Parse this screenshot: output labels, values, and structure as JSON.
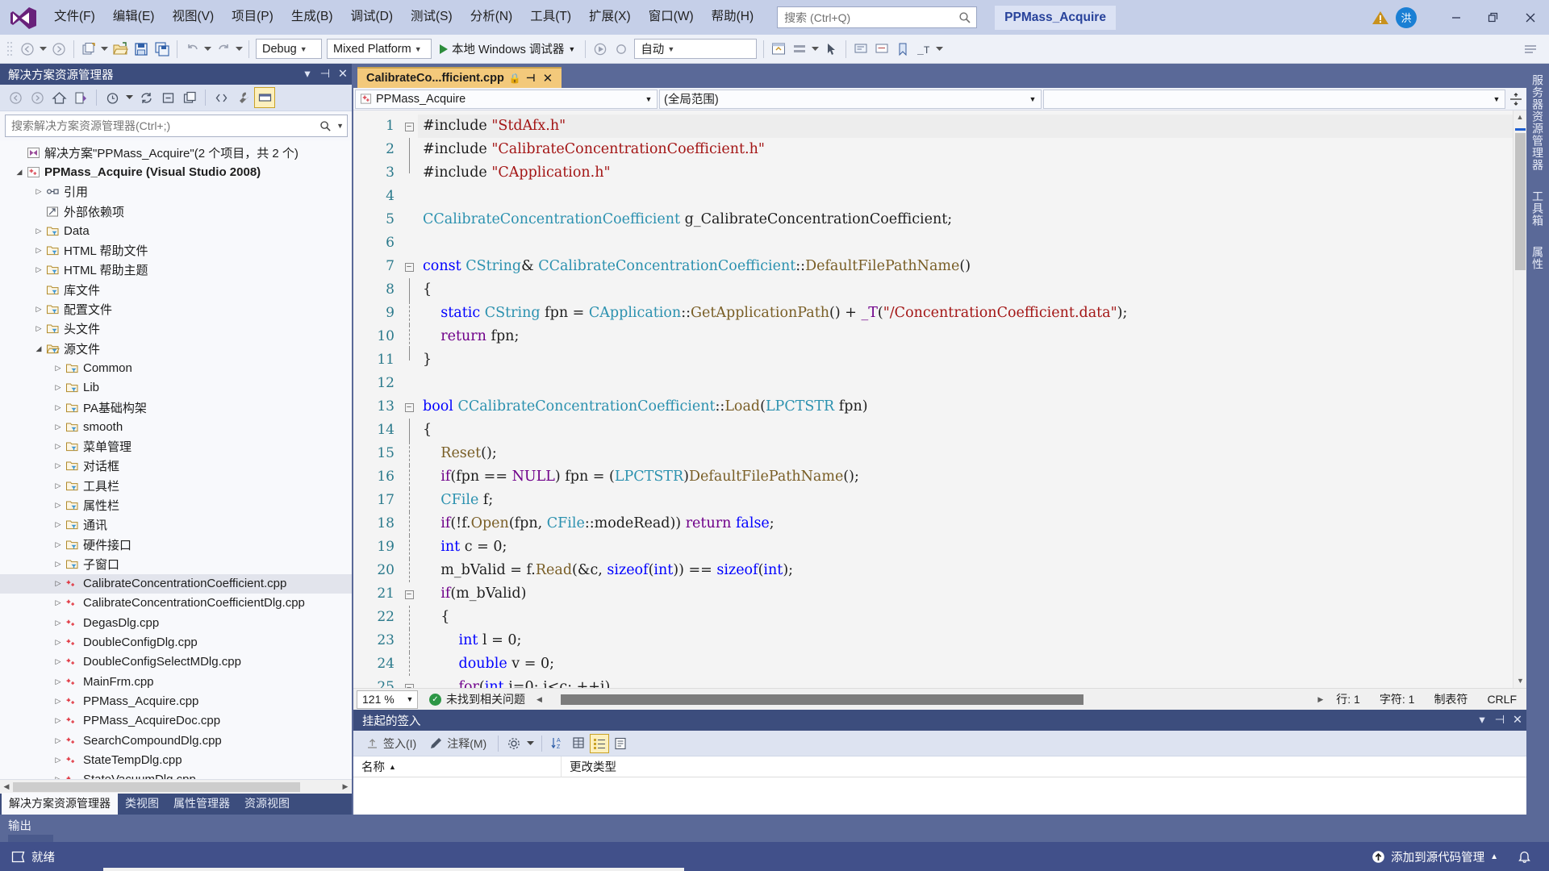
{
  "titlebar": {
    "menus": [
      {
        "label": "文件(F)"
      },
      {
        "label": "编辑(E)"
      },
      {
        "label": "视图(V)"
      },
      {
        "label": "项目(P)"
      },
      {
        "label": "生成(B)"
      },
      {
        "label": "调试(D)"
      },
      {
        "label": "测试(S)"
      },
      {
        "label": "分析(N)"
      },
      {
        "label": "工具(T)"
      },
      {
        "label": "扩展(X)"
      },
      {
        "label": "窗口(W)"
      },
      {
        "label": "帮助(H)"
      }
    ],
    "search_placeholder": "搜索 (Ctrl+Q)",
    "project_title": "PPMass_Acquire",
    "avatar_initial": "洪",
    "logo_name": "visual-studio-logo",
    "minimize": "—",
    "restore": "❐",
    "close": "✕"
  },
  "toolbar": {
    "config": "Debug",
    "platform": "Mixed Platform",
    "run_label": "本地 Windows 调试器",
    "auto": "自动"
  },
  "solution_explorer": {
    "title": "解决方案资源管理器",
    "search_placeholder": "搜索解决方案资源管理器(Ctrl+;)",
    "tree": [
      {
        "depth": 0,
        "arrow": "",
        "icon": "solution-icon",
        "label": "解决方案\"PPMass_Acquire\"(2 个项目，共 2 个)",
        "bold": false
      },
      {
        "depth": 0,
        "arrow": "▲",
        "icon": "cpp-project-icon",
        "label": "PPMass_Acquire (Visual Studio 2008)",
        "bold": true
      },
      {
        "depth": 1,
        "arrow": "▶",
        "icon": "references-icon",
        "label": "引用",
        "bold": false
      },
      {
        "depth": 1,
        "arrow": "",
        "icon": "external-deps-icon",
        "label": "外部依赖项",
        "bold": false
      },
      {
        "depth": 1,
        "arrow": "▶",
        "icon": "filter-folder-icon",
        "label": "Data",
        "bold": false
      },
      {
        "depth": 1,
        "arrow": "▶",
        "icon": "filter-folder-icon",
        "label": "HTML 帮助文件",
        "bold": false
      },
      {
        "depth": 1,
        "arrow": "▶",
        "icon": "filter-folder-icon",
        "label": "HTML 帮助主题",
        "bold": false
      },
      {
        "depth": 1,
        "arrow": "",
        "icon": "filter-folder-icon",
        "label": "库文件",
        "bold": false
      },
      {
        "depth": 1,
        "arrow": "▶",
        "icon": "filter-folder-icon",
        "label": "配置文件",
        "bold": false
      },
      {
        "depth": 1,
        "arrow": "▶",
        "icon": "filter-folder-icon",
        "label": "头文件",
        "bold": false
      },
      {
        "depth": 1,
        "arrow": "▲",
        "icon": "filter-folder-open-icon",
        "label": "源文件",
        "bold": false
      },
      {
        "depth": 2,
        "arrow": "▶",
        "icon": "filter-folder-icon",
        "label": "Common",
        "bold": false
      },
      {
        "depth": 2,
        "arrow": "▶",
        "icon": "filter-folder-icon",
        "label": "Lib",
        "bold": false
      },
      {
        "depth": 2,
        "arrow": "▶",
        "icon": "filter-folder-icon",
        "label": "PA基础构架",
        "bold": false
      },
      {
        "depth": 2,
        "arrow": "▶",
        "icon": "filter-folder-icon",
        "label": "smooth",
        "bold": false
      },
      {
        "depth": 2,
        "arrow": "▶",
        "icon": "filter-folder-icon",
        "label": "菜单管理",
        "bold": false
      },
      {
        "depth": 2,
        "arrow": "▶",
        "icon": "filter-folder-icon",
        "label": "对话框",
        "bold": false
      },
      {
        "depth": 2,
        "arrow": "▶",
        "icon": "filter-folder-icon",
        "label": "工具栏",
        "bold": false
      },
      {
        "depth": 2,
        "arrow": "▶",
        "icon": "filter-folder-icon",
        "label": "属性栏",
        "bold": false
      },
      {
        "depth": 2,
        "arrow": "▶",
        "icon": "filter-folder-icon",
        "label": "通讯",
        "bold": false
      },
      {
        "depth": 2,
        "arrow": "▶",
        "icon": "filter-folder-icon",
        "label": "硬件接口",
        "bold": false
      },
      {
        "depth": 2,
        "arrow": "▶",
        "icon": "filter-folder-icon",
        "label": "子窗口",
        "bold": false
      },
      {
        "depth": 2,
        "arrow": "▶",
        "icon": "cpp-file-icon",
        "label": "CalibrateConcentrationCoefficient.cpp",
        "bold": false,
        "selected": true
      },
      {
        "depth": 2,
        "arrow": "▶",
        "icon": "cpp-file-icon",
        "label": "CalibrateConcentrationCoefficientDlg.cpp",
        "bold": false
      },
      {
        "depth": 2,
        "arrow": "▶",
        "icon": "cpp-file-icon",
        "label": "DegasDlg.cpp",
        "bold": false
      },
      {
        "depth": 2,
        "arrow": "▶",
        "icon": "cpp-file-icon",
        "label": "DoubleConfigDlg.cpp",
        "bold": false
      },
      {
        "depth": 2,
        "arrow": "▶",
        "icon": "cpp-file-icon",
        "label": "DoubleConfigSelectMDlg.cpp",
        "bold": false
      },
      {
        "depth": 2,
        "arrow": "▶",
        "icon": "cpp-file-icon",
        "label": "MainFrm.cpp",
        "bold": false
      },
      {
        "depth": 2,
        "arrow": "▶",
        "icon": "cpp-file-icon",
        "label": "PPMass_Acquire.cpp",
        "bold": false
      },
      {
        "depth": 2,
        "arrow": "▶",
        "icon": "cpp-file-icon",
        "label": "PPMass_AcquireDoc.cpp",
        "bold": false
      },
      {
        "depth": 2,
        "arrow": "▶",
        "icon": "cpp-file-icon",
        "label": "SearchCompoundDlg.cpp",
        "bold": false
      },
      {
        "depth": 2,
        "arrow": "▶",
        "icon": "cpp-file-icon",
        "label": "StateTempDlg.cpp",
        "bold": false
      },
      {
        "depth": 2,
        "arrow": "▶",
        "icon": "cpp-file-icon",
        "label": "StateVacuumDlg.cpp",
        "bold": false
      }
    ],
    "tabs": [
      {
        "label": "解决方案资源管理器",
        "active": true
      },
      {
        "label": "类视图",
        "active": false
      },
      {
        "label": "属性管理器",
        "active": false
      },
      {
        "label": "资源视图",
        "active": false
      }
    ]
  },
  "editor": {
    "tab_label": "CalibrateCo...fficient.cpp",
    "tab_lock": "🔒",
    "tab_pin": "⊣",
    "tab_close": "✕",
    "nav_left": "PPMass_Acquire",
    "nav_right": "(全局范围)",
    "nav_far": "",
    "zoom": "121 %",
    "issues": "未找到相关问题",
    "line": "行: 1",
    "col": "字符: 1",
    "tabmode": "制表符",
    "eol": "CRLF",
    "lines": [
      {
        "n": 1,
        "fold": "minus",
        "tokens": [
          {
            "t": "#include ",
            "c": "df"
          },
          {
            "t": "\"StdAfx.h\"",
            "c": "s"
          }
        ]
      },
      {
        "n": 2,
        "fold": "bar",
        "tokens": [
          {
            "t": "#include ",
            "c": "df"
          },
          {
            "t": "\"CalibrateConcentrationCoefficient.h\"",
            "c": "s"
          }
        ]
      },
      {
        "n": 3,
        "fold": "barend",
        "tokens": [
          {
            "t": "#include ",
            "c": "df"
          },
          {
            "t": "\"CApplication.h\"",
            "c": "s"
          }
        ]
      },
      {
        "n": 4,
        "fold": "",
        "tokens": []
      },
      {
        "n": 5,
        "fold": "",
        "tokens": [
          {
            "t": "CCalibrateConcentrationCoefficient",
            "c": "kt"
          },
          {
            "t": " g_CalibrateConcentrationCoefficient;",
            "c": "df"
          }
        ]
      },
      {
        "n": 6,
        "fold": "",
        "tokens": []
      },
      {
        "n": 7,
        "fold": "minus",
        "tokens": [
          {
            "t": "const",
            "c": "k"
          },
          {
            "t": " ",
            "c": "df"
          },
          {
            "t": "CString",
            "c": "kt"
          },
          {
            "t": "& ",
            "c": "df"
          },
          {
            "t": "CCalibrateConcentrationCoefficient",
            "c": "kt"
          },
          {
            "t": "::",
            "c": "df"
          },
          {
            "t": "DefaultFilePathName",
            "c": "fn"
          },
          {
            "t": "()",
            "c": "df"
          }
        ]
      },
      {
        "n": 8,
        "fold": "bar",
        "tokens": [
          {
            "t": "{",
            "c": "df"
          }
        ]
      },
      {
        "n": 9,
        "fold": "dot",
        "tokens": [
          {
            "t": "    ",
            "c": "df"
          },
          {
            "t": "static",
            "c": "k"
          },
          {
            "t": " ",
            "c": "df"
          },
          {
            "t": "CString",
            "c": "kt"
          },
          {
            "t": " fpn = ",
            "c": "df"
          },
          {
            "t": "CApplication",
            "c": "kt"
          },
          {
            "t": "::",
            "c": "df"
          },
          {
            "t": "GetApplicationPath",
            "c": "fn"
          },
          {
            "t": "() + ",
            "c": "df"
          },
          {
            "t": "_T",
            "c": "pp"
          },
          {
            "t": "(",
            "c": "df"
          },
          {
            "t": "\"/ConcentrationCoefficient.data\"",
            "c": "s"
          },
          {
            "t": ");",
            "c": "df"
          }
        ]
      },
      {
        "n": 10,
        "fold": "dot",
        "tokens": [
          {
            "t": "    ",
            "c": "df"
          },
          {
            "t": "return",
            "c": "pp"
          },
          {
            "t": " fpn;",
            "c": "df"
          }
        ]
      },
      {
        "n": 11,
        "fold": "barend",
        "tokens": [
          {
            "t": "}",
            "c": "df"
          }
        ]
      },
      {
        "n": 12,
        "fold": "",
        "tokens": []
      },
      {
        "n": 13,
        "fold": "minus",
        "tokens": [
          {
            "t": "bool",
            "c": "k"
          },
          {
            "t": " ",
            "c": "df"
          },
          {
            "t": "CCalibrateConcentrationCoefficient",
            "c": "kt"
          },
          {
            "t": "::",
            "c": "df"
          },
          {
            "t": "Load",
            "c": "fn"
          },
          {
            "t": "(",
            "c": "df"
          },
          {
            "t": "LPCTSTR",
            "c": "kt"
          },
          {
            "t": " fpn)",
            "c": "df"
          }
        ]
      },
      {
        "n": 14,
        "fold": "bar",
        "tokens": [
          {
            "t": "{",
            "c": "df"
          }
        ]
      },
      {
        "n": 15,
        "fold": "dot",
        "tokens": [
          {
            "t": "    ",
            "c": "df"
          },
          {
            "t": "Reset",
            "c": "fn"
          },
          {
            "t": "();",
            "c": "df"
          }
        ]
      },
      {
        "n": 16,
        "fold": "dot",
        "tokens": [
          {
            "t": "    ",
            "c": "df"
          },
          {
            "t": "if",
            "c": "pp"
          },
          {
            "t": "(fpn == ",
            "c": "df"
          },
          {
            "t": "NULL",
            "c": "pp"
          },
          {
            "t": ") fpn = (",
            "c": "df"
          },
          {
            "t": "LPCTSTR",
            "c": "kt"
          },
          {
            "t": ")",
            "c": "df"
          },
          {
            "t": "DefaultFilePathName",
            "c": "fn"
          },
          {
            "t": "();",
            "c": "df"
          }
        ]
      },
      {
        "n": 17,
        "fold": "dot",
        "tokens": [
          {
            "t": "    ",
            "c": "df"
          },
          {
            "t": "CFile",
            "c": "kt"
          },
          {
            "t": " f;",
            "c": "df"
          }
        ]
      },
      {
        "n": 18,
        "fold": "dot",
        "tokens": [
          {
            "t": "    ",
            "c": "df"
          },
          {
            "t": "if",
            "c": "pp"
          },
          {
            "t": "(!f.",
            "c": "df"
          },
          {
            "t": "Open",
            "c": "fn"
          },
          {
            "t": "(fpn, ",
            "c": "df"
          },
          {
            "t": "CFile",
            "c": "kt"
          },
          {
            "t": "::modeRead)) ",
            "c": "df"
          },
          {
            "t": "return",
            "c": "pp"
          },
          {
            "t": " ",
            "c": "df"
          },
          {
            "t": "false",
            "c": "k"
          },
          {
            "t": ";",
            "c": "df"
          }
        ]
      },
      {
        "n": 19,
        "fold": "dot",
        "tokens": [
          {
            "t": "    ",
            "c": "df"
          },
          {
            "t": "int",
            "c": "k"
          },
          {
            "t": " c = ",
            "c": "df"
          },
          {
            "t": "0",
            "c": "df"
          },
          {
            "t": ";",
            "c": "df"
          }
        ]
      },
      {
        "n": 20,
        "fold": "dot",
        "tokens": [
          {
            "t": "    m_bValid = f.",
            "c": "df"
          },
          {
            "t": "Read",
            "c": "fn"
          },
          {
            "t": "(&c, ",
            "c": "df"
          },
          {
            "t": "sizeof",
            "c": "k"
          },
          {
            "t": "(",
            "c": "df"
          },
          {
            "t": "int",
            "c": "k"
          },
          {
            "t": ")) == ",
            "c": "df"
          },
          {
            "t": "sizeof",
            "c": "k"
          },
          {
            "t": "(",
            "c": "df"
          },
          {
            "t": "int",
            "c": "k"
          },
          {
            "t": ");",
            "c": "df"
          }
        ]
      },
      {
        "n": 21,
        "fold": "minus2",
        "tokens": [
          {
            "t": "    ",
            "c": "df"
          },
          {
            "t": "if",
            "c": "pp"
          },
          {
            "t": "(m_bValid)",
            "c": "df"
          }
        ]
      },
      {
        "n": 22,
        "fold": "dot",
        "tokens": [
          {
            "t": "    {",
            "c": "df"
          }
        ]
      },
      {
        "n": 23,
        "fold": "dot2",
        "tokens": [
          {
            "t": "        ",
            "c": "df"
          },
          {
            "t": "int",
            "c": "k"
          },
          {
            "t": " l = ",
            "c": "df"
          },
          {
            "t": "0",
            "c": "df"
          },
          {
            "t": ";",
            "c": "df"
          }
        ]
      },
      {
        "n": 24,
        "fold": "dot2",
        "tokens": [
          {
            "t": "        ",
            "c": "df"
          },
          {
            "t": "double",
            "c": "k"
          },
          {
            "t": " v = ",
            "c": "df"
          },
          {
            "t": "0",
            "c": "df"
          },
          {
            "t": ";",
            "c": "df"
          }
        ]
      },
      {
        "n": 25,
        "fold": "minus3",
        "tokens": [
          {
            "t": "        ",
            "c": "df"
          },
          {
            "t": "for",
            "c": "pp"
          },
          {
            "t": "(",
            "c": "df"
          },
          {
            "t": "int",
            "c": "k"
          },
          {
            "t": " i=",
            "c": "df"
          },
          {
            "t": "0",
            "c": "df"
          },
          {
            "t": "; i<c; ++i)",
            "c": "df"
          }
        ]
      }
    ]
  },
  "pending": {
    "title": "挂起的签入",
    "checkin_label": "签入(I)",
    "comment_label": "注释(M)",
    "col_name": "名称",
    "col_sort_arrow": "▲",
    "col_change_type": "更改类型"
  },
  "right_tabs": [
    {
      "label": "服务器资源管理器"
    },
    {
      "label": "工具箱"
    },
    {
      "label": "属性"
    }
  ],
  "output": {
    "label": "输出"
  },
  "statusbar": {
    "ready": "就绪",
    "source_control": "添加到源代码管理",
    "caret": "▲",
    "bell": "bell-icon"
  },
  "colors": {
    "accent_blue": "#41508a",
    "panel_header": "#3c4d7d",
    "title_bar": "#c5cfe8",
    "tab_active": "#f3c97b",
    "editor_bg": "#f4f4f4",
    "keyword": "#0000ff",
    "type": "#2b91af",
    "string": "#a31515",
    "macro": "#6f008a",
    "function": "#795e26"
  }
}
